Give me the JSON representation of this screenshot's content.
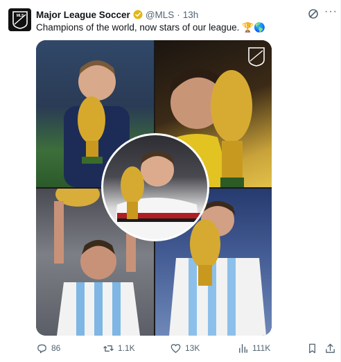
{
  "post": {
    "author_name": "Major League Soccer",
    "handle": "@MLS",
    "separator": "·",
    "time": "13h",
    "text": "Champions of the world, now stars of our league. 🏆🌎",
    "more_label": "···",
    "avatar_text": "MLS"
  },
  "actions": {
    "replies": "86",
    "reposts": "1.1K",
    "likes": "13K",
    "views": "111K"
  },
  "colors": {
    "verified": "#e2b719",
    "muted": "#536471",
    "text": "#0f1419"
  }
}
